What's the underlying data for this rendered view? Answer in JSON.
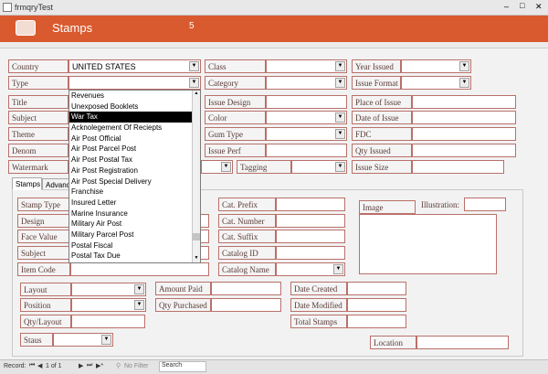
{
  "window": {
    "title": "frmqryTest",
    "min": "–",
    "max": "□",
    "close": "✕"
  },
  "header": {
    "title": "Stamps",
    "counter": "5"
  },
  "top": {
    "country_label": "Country",
    "country_value": "UNITED STATES",
    "type_label": "Type",
    "type_value": "",
    "title_label": "Title",
    "subject_label": "Subject",
    "theme_label": "Theme",
    "denom_label": "Denom",
    "watermark_label": "Watermark",
    "class_label": "Class",
    "category_label": "Category",
    "issue_design_label": "Issue Design",
    "color_label": "Color",
    "gum_type_label": "Gum Type",
    "issue_perf_label": "Issue Perf",
    "tagging_label": "Tagging",
    "year_issued_label": "Year Issued",
    "issue_format_label": "Issue Format",
    "place_of_issue_label": "Place of Issue",
    "date_of_issue_label": "Date of Issue",
    "fdc_label": "FDC",
    "qty_issued_label": "Qty Issued",
    "issue_size_label": "Issue Size"
  },
  "type_dropdown": {
    "items": [
      "Revenues",
      "Unexposed Booklets",
      "War Tax",
      "Acknolegement Of Reciepts",
      "Air Post Official",
      "Air Post Parcel Post",
      "Air Post Postal Tax",
      "Air Post Registration",
      "Air Post Special Delivery",
      "Franchise",
      "Insured Letter",
      "Marine Insurance",
      "Military Air Post",
      "Military Parcel Post",
      "Postal Fiscal",
      "Postal Tax Due"
    ],
    "selected": "War Tax"
  },
  "tabs": {
    "tab1": "Stamps",
    "tab2": "Advanc"
  },
  "detail": {
    "stamp_type_label": "Stamp Type",
    "design_label": "Design",
    "face_value_label": "Face Value",
    "subject_label": "Subject",
    "item_code_label": "Item Code",
    "cat_prefix_label": "Cat. Prefix",
    "cat_number_label": "Cat. Number",
    "cat_suffix_label": "Cat. Suffix",
    "catalog_id_label": "Catalog ID",
    "catalog_name_label": "Catalog Name",
    "image_label": "Image",
    "illustration_label": "Illustration:",
    "layout_label": "Layout",
    "position_label": "Position",
    "qty_layout_label": "Qty/Layout",
    "amount_paid_label": "Amount Paid",
    "qty_purchased_label": "Qty Purchased",
    "date_created_label": "Date Created",
    "date_modified_label": "Date Modified",
    "total_stamps_label": "Total Stamps",
    "staus_label": "Staus",
    "location_label": "Location"
  },
  "record_bar": {
    "label": "Record:",
    "position": "1 of 1",
    "no_filter": "No Filter",
    "search": "Search"
  },
  "colors": {
    "header": "#d95a2e",
    "border": "#b9706a"
  }
}
